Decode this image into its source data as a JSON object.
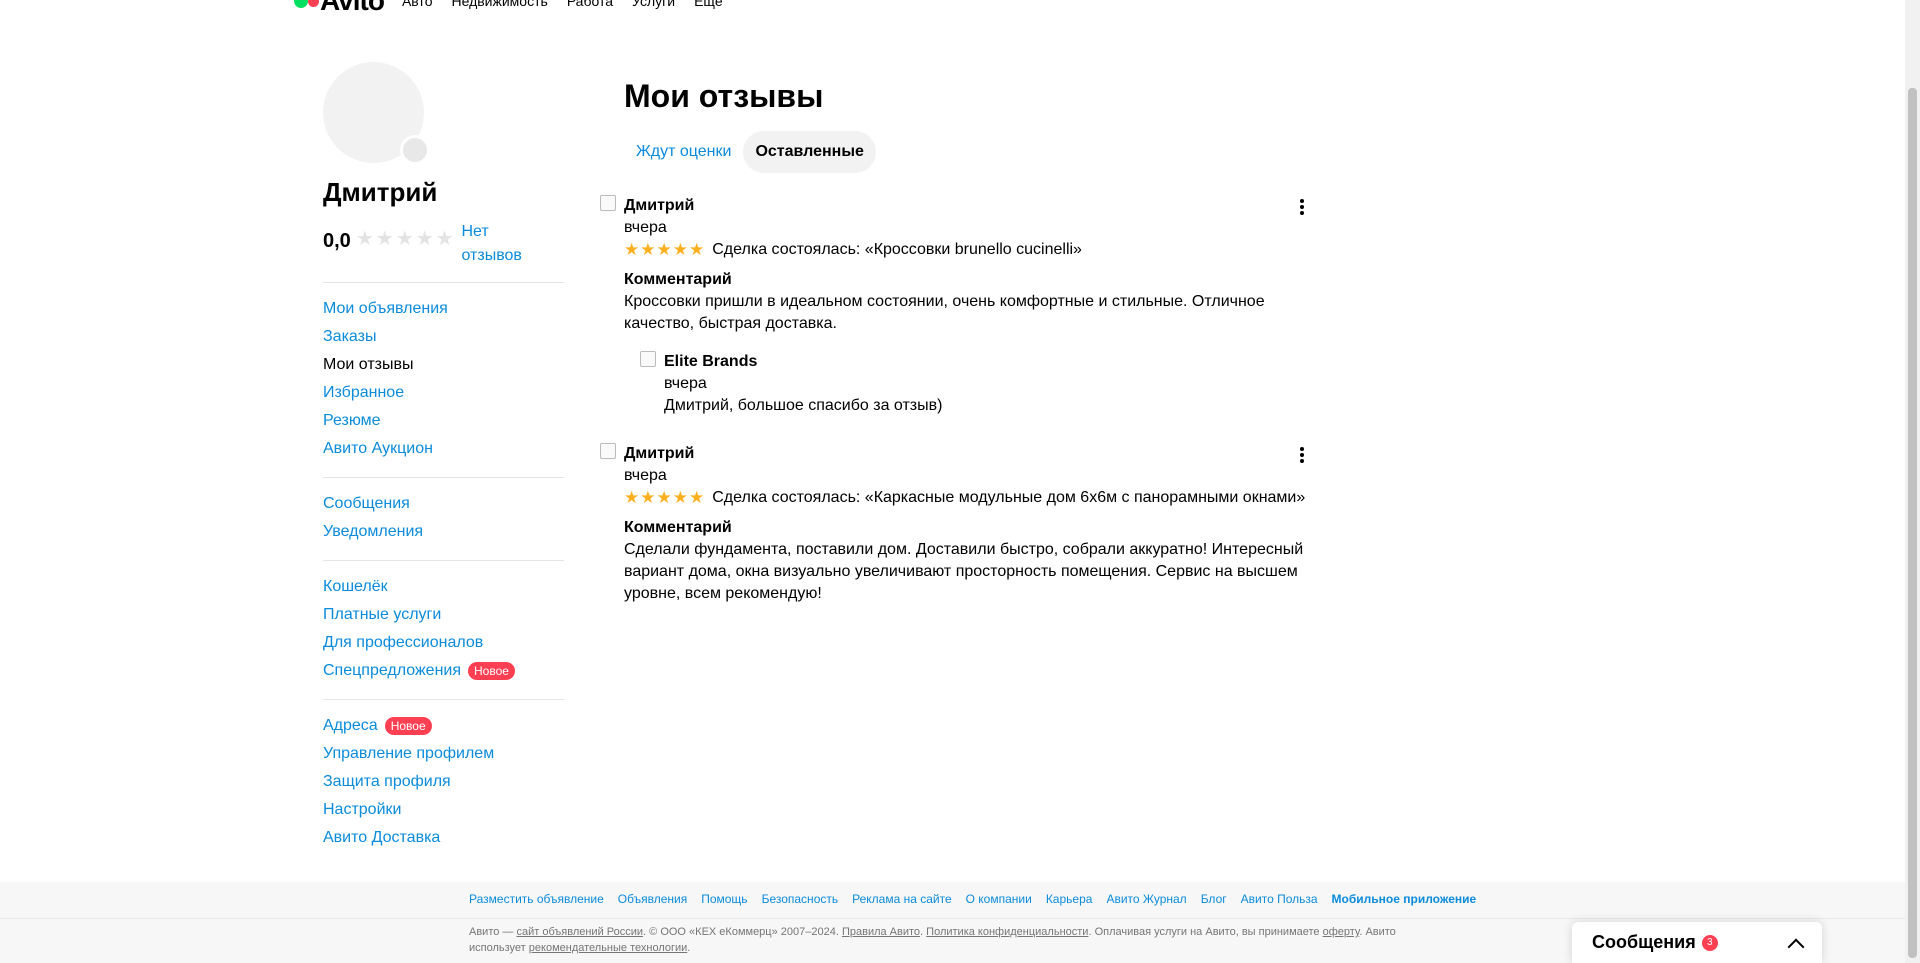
{
  "topnav": {
    "logo": "Avito",
    "items": [
      "Авто",
      "Недвижимость",
      "Работа",
      "Услуги",
      "Ещё"
    ]
  },
  "profile": {
    "name": "Дмитрий",
    "rating": "0,0",
    "no_reviews": "Нет отзывов"
  },
  "sidebar": {
    "group1": [
      "Мои объявления",
      "Заказы",
      "Мои отзывы",
      "Избранное",
      "Резюме",
      "Авито Аукцион"
    ],
    "group2": [
      "Сообщения",
      "Уведомления"
    ],
    "group3": [
      "Кошелёк",
      "Платные услуги",
      "Для профессионалов",
      "Спецпредложения"
    ],
    "group4": [
      "Адреса",
      "Управление профилем",
      "Защита профиля",
      "Настройки",
      "Авито Доставка"
    ],
    "new_badge": "Новое"
  },
  "main": {
    "title": "Мои отзывы",
    "tabs": [
      "Ждут оценки",
      "Оставленные"
    ]
  },
  "reviews": [
    {
      "author": "Дмитрий",
      "date": "вчера",
      "rating": 5,
      "deal": "Сделка состоялась: «Кроссовки brunello cucinelli»",
      "comment_title": "Комментарий",
      "comment": "Кроссовки пришли в идеальном состоянии, очень комфортные и стильные. Отличное качество, быстрая доставка.",
      "reply": {
        "author": "Elite Brands",
        "date": "вчера",
        "text": "Дмитрий, большое спасибо за отзыв)"
      }
    },
    {
      "author": "Дмитрий",
      "date": "вчера",
      "rating": 5,
      "deal": "Сделка состоялась: «Каркасные модульные дом 6х6м с панорамными окнами»",
      "comment_title": "Комментарий",
      "comment": "Сделали фундамента, поставили дом. Доставили быстро, собрали аккуратно! Интересный вариант дома, окна визуально увеличивают просторность помещения. Сервис на высшем уровне, всем рекомендую!"
    }
  ],
  "footer": {
    "links": [
      "Разместить объявление",
      "Объявления",
      "Помощь",
      "Безопасность",
      "Реклама на сайте",
      "О компании",
      "Карьера",
      "Авито Журнал",
      "Блог",
      "Авито Польза",
      "Мобильное приложение"
    ],
    "legal_1": "Авито — ",
    "legal_link1": "сайт объявлений России",
    "legal_2": ". © ООО «КЕХ еКоммерц» 2007–2024. ",
    "legal_link2": "Правила Авито",
    "legal_3": ". ",
    "legal_link3": "Политика конфиденциальности",
    "legal_4": ". Оплачивая услуги на Авито, вы принимаете ",
    "legal_link4": "оферту",
    "legal_5": ". Авито использует ",
    "legal_link5": "рекомендательные технологии",
    "legal_6": "."
  },
  "messages_widget": {
    "title": "Сообщения",
    "count": "3"
  }
}
